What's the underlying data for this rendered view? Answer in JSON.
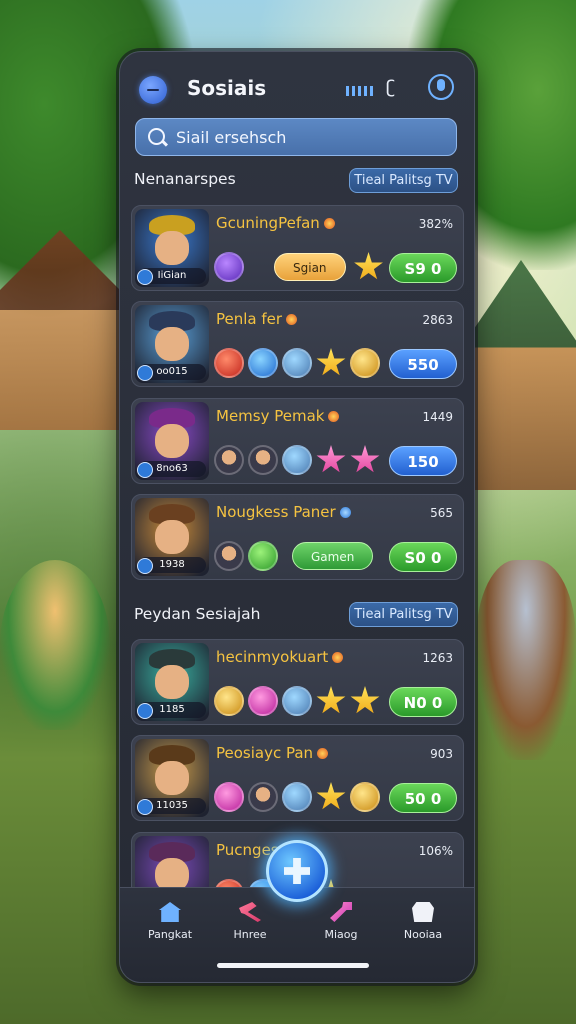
{
  "header": {
    "title": "Sosiais"
  },
  "search": {
    "text": "Siail ersehsch"
  },
  "sections": [
    {
      "title": "Nenanarspes",
      "button": "Tieal Palitsg TV"
    },
    {
      "title": "Peydan Sesiajah",
      "button": "Tieal Palitsg TV"
    }
  ],
  "players": [
    {
      "name": "GcuningPefan",
      "score": "382%",
      "avatar_label": "IiGian",
      "mid_label": "Sgian",
      "value": "S9 0",
      "value_color": "green",
      "hat": "#c9a020",
      "bg": "#3a7ad0"
    },
    {
      "name": "Penla fer",
      "score": "2863",
      "avatar_label": "oo015",
      "mid_label": "",
      "value": "550",
      "value_color": "blue",
      "hat": "#2a3a5a",
      "bg": "#5aa0d8"
    },
    {
      "name": "Memsy Pemak",
      "score": "1449",
      "avatar_label": "8no63",
      "mid_label": "",
      "value": "150",
      "value_color": "blue",
      "hat": "#7a2a8a",
      "bg": "#8a4ac8"
    },
    {
      "name": "Nougkess Paner",
      "score": "565",
      "avatar_label": "1938",
      "mid_label": "Gamen",
      "value": "S0 0",
      "value_color": "green",
      "hat": "#6a4020",
      "bg": "#c88a3a"
    },
    {
      "name": "hecinmyokuart",
      "score": "1263",
      "avatar_label": "1185",
      "mid_label": "",
      "value": "N0 0",
      "value_color": "green",
      "hat": "#2a3a3a",
      "bg": "#3ab0a0"
    },
    {
      "name": "Peosiayc Pan",
      "score": "903",
      "avatar_label": "11035",
      "mid_label": "",
      "value": "50 0",
      "value_color": "green",
      "hat": "#5a3a1a",
      "bg": "#c89a4a"
    },
    {
      "name": "Pucngesr",
      "score": "106%",
      "avatar_label": "",
      "mid_label": "",
      "value": "",
      "value_color": "green",
      "hat": "#5a2a5a",
      "bg": "#7a4ab8"
    }
  ],
  "nav": [
    {
      "label": "Pangkat",
      "icon": "home-icon"
    },
    {
      "label": "Hnree",
      "icon": "hammer-icon"
    },
    {
      "label": "Miaog",
      "icon": "key-icon"
    },
    {
      "label": "Nooiaa",
      "icon": "shop-icon"
    }
  ],
  "colors": {
    "accent": "#6fb2ff",
    "gold": "#f5c341",
    "panel": "#2f3440"
  }
}
